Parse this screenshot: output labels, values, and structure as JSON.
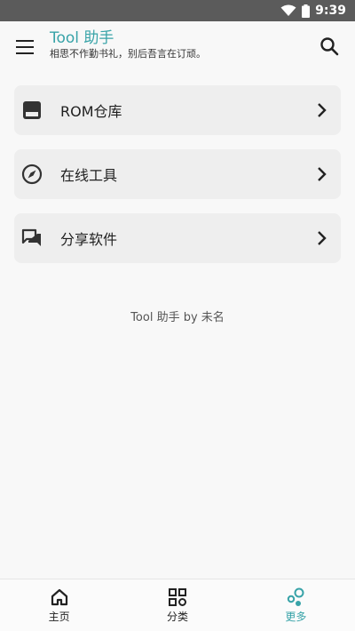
{
  "status_bar": {
    "time": "9:39"
  },
  "app_bar": {
    "title": "Tool 助手",
    "subtitle": "相思不作勤书礼，别后吾言在订顽。",
    "title_color": "#38a3a8"
  },
  "menu": [
    {
      "label": "ROM仓库",
      "icon": "storage-icon"
    },
    {
      "label": "在线工具",
      "icon": "compass-icon"
    },
    {
      "label": "分享软件",
      "icon": "forum-icon"
    }
  ],
  "credit": "Tool 助手 by 未名",
  "bottom_nav": [
    {
      "label": "主页",
      "icon": "home-icon",
      "active": false
    },
    {
      "label": "分类",
      "icon": "category-icon",
      "active": false
    },
    {
      "label": "更多",
      "icon": "more-bubbles-icon",
      "active": true
    }
  ],
  "colors": {
    "accent": "#38a3a8",
    "card_bg": "#eeeeee",
    "status_bar": "#5b5b5b"
  }
}
